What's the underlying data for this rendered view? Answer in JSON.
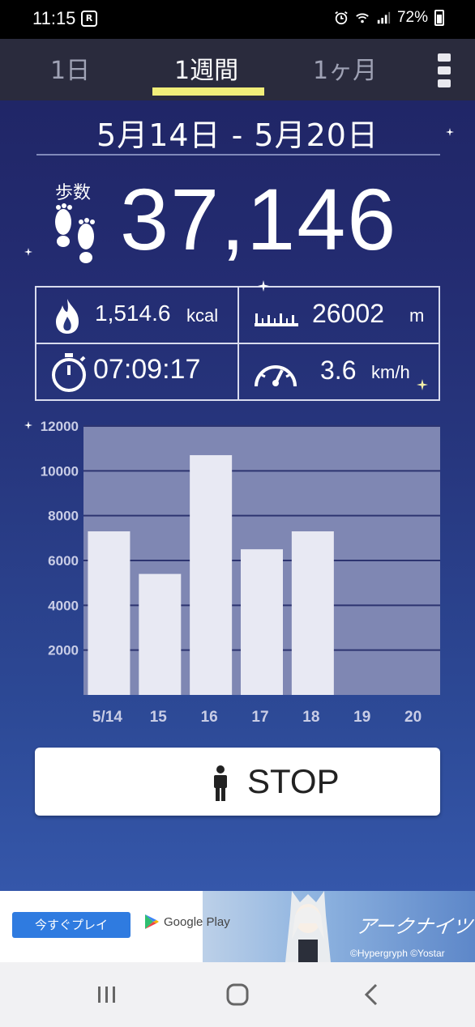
{
  "status_bar": {
    "time": "11:15",
    "battery": "72%"
  },
  "tabs": [
    {
      "label": "1日",
      "active": false
    },
    {
      "label": "1週間",
      "active": true
    },
    {
      "label": "1ヶ月",
      "active": false
    }
  ],
  "date_range": "5月14日 - 5月20日",
  "steps": {
    "label": "歩数",
    "value": "37,146"
  },
  "stats": {
    "calories": {
      "value": "1,514.6",
      "unit": "kcal"
    },
    "distance": {
      "value": "26002",
      "unit": "m"
    },
    "duration": {
      "value": "07:09:17"
    },
    "speed": {
      "value": "3.6",
      "unit": "km/h"
    }
  },
  "chart_data": {
    "type": "bar",
    "categories": [
      "5/14",
      "15",
      "16",
      "17",
      "18",
      "19",
      "20"
    ],
    "values": [
      7300,
      5400,
      10700,
      6500,
      7300,
      0,
      0
    ],
    "ylim": [
      0,
      12000
    ],
    "yticks": [
      "2000",
      "4000",
      "6000",
      "8000",
      "10000",
      "12000"
    ],
    "grid": true,
    "bar_color": "#e8e9f3",
    "plot_bg": "#7f87b3"
  },
  "stop_button": {
    "label": "STOP"
  },
  "ad": {
    "cta_label": "今すぐプレイ",
    "store_label": "Google Play",
    "logo_text": "アークナイツ",
    "credit": "©Hypergryph ©Yostar"
  },
  "colors": {
    "tab_underline": "#f1ee7a",
    "tab_bar": "#2a2b3d",
    "ad_cta": "#2f7be0"
  }
}
